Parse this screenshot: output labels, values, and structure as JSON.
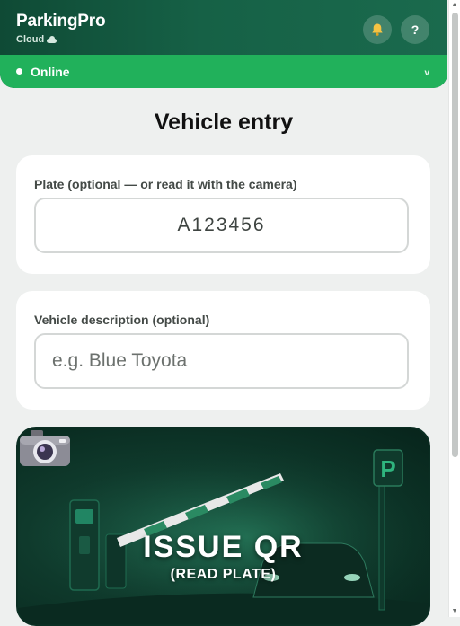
{
  "header": {
    "brand_name": "ParkingPro",
    "brand_sub": "Cloud",
    "notifications_icon": "bell-icon",
    "help_label": "?"
  },
  "status": {
    "label": "Online",
    "chevron": "v",
    "color": "#21b15b"
  },
  "page": {
    "title": "Vehicle entry"
  },
  "plate_field": {
    "label": "Plate (optional — or read it with the camera)",
    "value": "A123456"
  },
  "description_field": {
    "label": "Vehicle description (optional)",
    "value": "",
    "placeholder": "e.g. Blue Toyota"
  },
  "issue_button": {
    "title": "ISSUE QR",
    "subtitle": "(READ PLATE)",
    "icon": "camera-icon",
    "sign_letter": "P"
  },
  "colors": {
    "header": "#166146",
    "accent": "#21b15b"
  }
}
